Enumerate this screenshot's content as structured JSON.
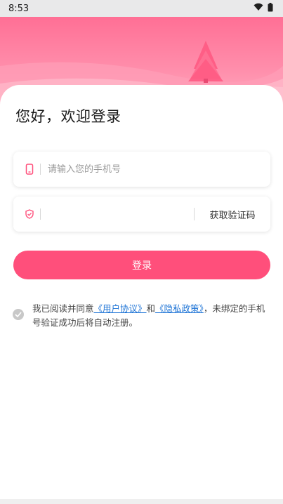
{
  "status_bar": {
    "time": "8:53"
  },
  "greeting": "您好，欢迎登录",
  "phone_field": {
    "placeholder": "请输入您的手机号",
    "value": ""
  },
  "code_field": {
    "placeholder": "",
    "value": "",
    "get_code_label": "获取验证码"
  },
  "login_button": {
    "label": "登录"
  },
  "agreement": {
    "prefix": "我已阅读并同意",
    "user_agreement": "《用户协议》",
    "and": "和",
    "privacy_policy": "《隐私政策》",
    "suffix": "，未绑定的手机号验证成功后将自动注册。"
  },
  "colors": {
    "accent": "#ff4f7b",
    "link": "#1e74d6",
    "hero": "#ff7a9c"
  },
  "icons": {
    "wifi": "wifi-icon",
    "battery": "battery-icon",
    "phone": "phone-icon",
    "shield": "shield-icon",
    "check": "check-icon"
  }
}
